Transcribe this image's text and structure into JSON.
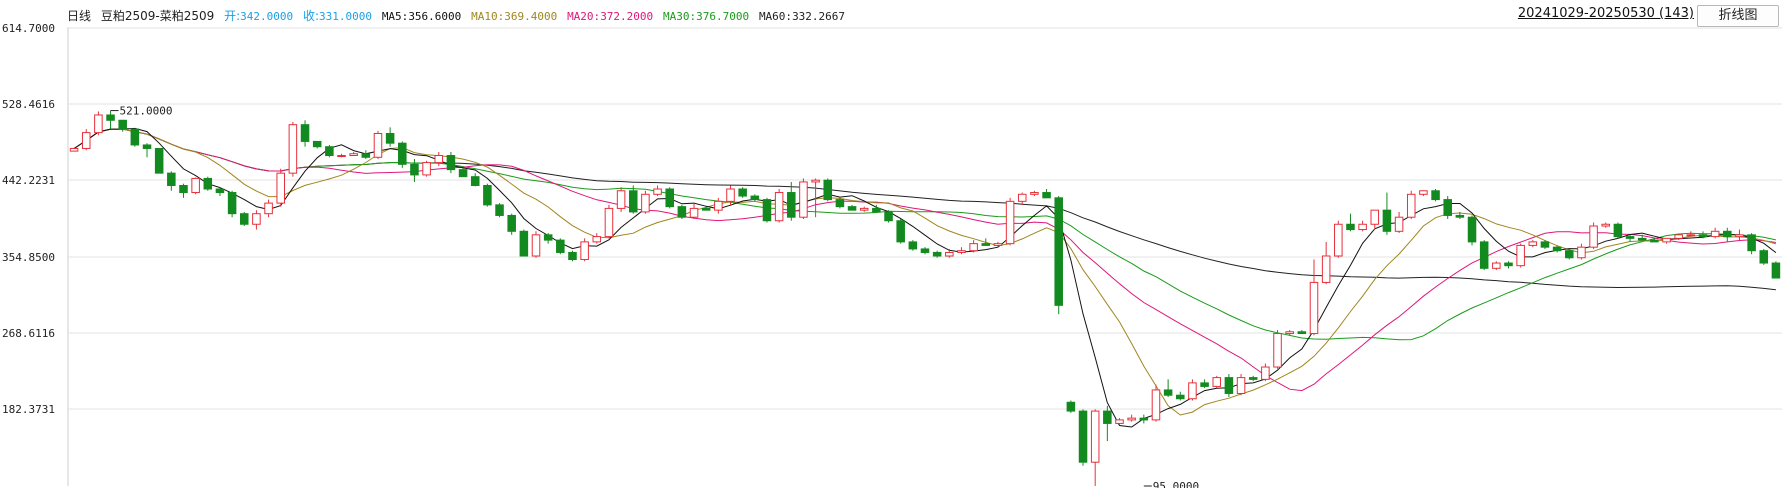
{
  "header": {
    "period": "日线",
    "symbol": "豆粕2509-菜粕2509",
    "open_label": "开:",
    "open_value": "342.0000",
    "close_label": "收:",
    "close_value": "331.0000",
    "ma5_label": "MA5:",
    "ma5_value": "356.6000",
    "ma10_label": "MA10:",
    "ma10_value": "369.4000",
    "ma20_label": "MA20:",
    "ma20_value": "372.2000",
    "ma30_label": "MA30:",
    "ma30_value": "376.7000",
    "ma60_label": "MA60:",
    "ma60_value": "332.2667"
  },
  "date_range": "20241029-20250530 (143)",
  "line_chart_button": "折线图",
  "colors": {
    "open": "#1aa0e6",
    "close": "#1aa0e6",
    "ma5": "#111111",
    "ma10": "#a0861e",
    "ma20": "#e0167a",
    "ma30": "#1a9c1a",
    "ma60": "#222222",
    "up": "#e8303a",
    "down": "#138a1f",
    "grid": "#e3e3e3"
  },
  "chart_data": {
    "type": "candlestick",
    "count": 143,
    "ylim": [
      95,
      614.7
    ],
    "y_ticks": [
      {
        "value": 614.7,
        "label": "614.7000"
      },
      {
        "value": 528.4616,
        "label": "528.4616"
      },
      {
        "value": 442.2231,
        "label": "442.2231"
      },
      {
        "value": 354.85,
        "label": "354.8500"
      },
      {
        "value": 268.6116,
        "label": "268.6116"
      },
      {
        "value": 182.3731,
        "label": "182.3731"
      }
    ],
    "annotations": [
      {
        "label": "521.0000",
        "value": 521.0,
        "index": 3
      },
      {
        "label": "95.0000",
        "value": 95.0,
        "index": 88
      }
    ],
    "ohlc": [
      [
        475,
        479,
        476,
        478
      ],
      [
        478,
        500,
        476,
        496
      ],
      [
        496,
        520,
        493,
        516
      ],
      [
        516,
        521,
        500,
        510
      ],
      [
        510,
        503,
        497,
        500
      ],
      [
        500,
        498,
        480,
        482
      ],
      [
        482,
        484,
        468,
        478
      ],
      [
        478,
        475,
        458,
        450
      ],
      [
        450,
        452,
        430,
        436
      ],
      [
        436,
        438,
        422,
        428
      ],
      [
        428,
        445,
        426,
        444
      ],
      [
        444,
        446,
        430,
        432
      ],
      [
        432,
        434,
        424,
        428
      ],
      [
        428,
        430,
        400,
        404
      ],
      [
        404,
        406,
        390,
        392
      ],
      [
        392,
        408,
        386,
        404
      ],
      [
        404,
        420,
        400,
        416
      ],
      [
        416,
        455,
        412,
        450
      ],
      [
        450,
        508,
        446,
        505
      ],
      [
        505,
        510,
        480,
        486
      ],
      [
        486,
        484,
        478,
        480
      ],
      [
        480,
        482,
        468,
        470
      ],
      [
        470,
        472,
        468,
        470
      ],
      [
        470,
        474,
        470,
        472
      ],
      [
        472,
        476,
        466,
        468
      ],
      [
        468,
        498,
        466,
        495
      ],
      [
        495,
        502,
        480,
        484
      ],
      [
        484,
        486,
        456,
        460
      ],
      [
        460,
        466,
        440,
        448
      ],
      [
        448,
        464,
        446,
        462
      ],
      [
        462,
        474,
        458,
        470
      ],
      [
        470,
        474,
        450,
        454
      ],
      [
        454,
        456,
        446,
        446
      ],
      [
        446,
        450,
        435,
        436
      ],
      [
        436,
        438,
        412,
        414
      ],
      [
        414,
        416,
        400,
        402
      ],
      [
        402,
        404,
        380,
        384
      ],
      [
        384,
        386,
        356,
        356
      ],
      [
        356,
        384,
        354,
        380
      ],
      [
        380,
        382,
        370,
        374
      ],
      [
        374,
        376,
        358,
        360
      ],
      [
        360,
        362,
        350,
        352
      ],
      [
        352,
        376,
        350,
        372
      ],
      [
        372,
        382,
        370,
        378
      ],
      [
        378,
        414,
        376,
        410
      ],
      [
        410,
        434,
        406,
        430
      ],
      [
        430,
        436,
        404,
        406
      ],
      [
        406,
        430,
        404,
        426
      ],
      [
        426,
        436,
        424,
        432
      ],
      [
        432,
        434,
        410,
        412
      ],
      [
        412,
        414,
        398,
        400
      ],
      [
        400,
        416,
        398,
        410
      ],
      [
        410,
        412,
        408,
        408
      ],
      [
        408,
        422,
        404,
        418
      ],
      [
        418,
        436,
        414,
        432
      ],
      [
        432,
        434,
        422,
        424
      ],
      [
        424,
        426,
        418,
        420
      ],
      [
        420,
        422,
        394,
        396
      ],
      [
        396,
        432,
        394,
        428
      ],
      [
        428,
        440,
        396,
        400
      ],
      [
        400,
        444,
        398,
        440
      ],
      [
        440,
        444,
        400,
        442
      ],
      [
        442,
        444,
        418,
        420
      ],
      [
        420,
        422,
        410,
        412
      ],
      [
        412,
        414,
        408,
        408
      ],
      [
        408,
        412,
        406,
        410
      ],
      [
        410,
        414,
        406,
        406
      ],
      [
        406,
        408,
        394,
        396
      ],
      [
        396,
        398,
        370,
        372
      ],
      [
        372,
        374,
        362,
        364
      ],
      [
        364,
        366,
        358,
        360
      ],
      [
        360,
        362,
        354,
        356
      ],
      [
        356,
        364,
        354,
        360
      ],
      [
        360,
        366,
        358,
        362
      ],
      [
        362,
        374,
        360,
        370
      ],
      [
        370,
        376,
        368,
        368
      ],
      [
        368,
        372,
        366,
        370
      ],
      [
        370,
        422,
        368,
        418
      ],
      [
        418,
        428,
        414,
        426
      ],
      [
        426,
        430,
        424,
        428
      ],
      [
        428,
        432,
        426,
        422
      ],
      [
        422,
        424,
        290,
        300
      ],
      [
        190,
        192,
        178,
        180
      ],
      [
        180,
        182,
        118,
        122
      ],
      [
        122,
        182,
        95,
        180
      ],
      [
        180,
        186,
        146,
        166
      ],
      [
        166,
        172,
        164,
        170
      ],
      [
        170,
        176,
        168,
        172
      ],
      [
        172,
        176,
        166,
        170
      ],
      [
        170,
        210,
        168,
        204
      ],
      [
        204,
        216,
        196,
        198
      ],
      [
        198,
        202,
        192,
        194
      ],
      [
        194,
        216,
        192,
        212
      ],
      [
        212,
        216,
        206,
        208
      ],
      [
        208,
        220,
        206,
        218
      ],
      [
        218,
        222,
        196,
        200
      ],
      [
        200,
        222,
        198,
        218
      ],
      [
        218,
        220,
        214,
        216
      ],
      [
        216,
        234,
        214,
        230
      ],
      [
        230,
        272,
        228,
        268
      ],
      [
        268,
        272,
        266,
        270
      ],
      [
        270,
        272,
        268,
        268
      ],
      [
        268,
        352,
        266,
        326
      ],
      [
        326,
        372,
        324,
        356
      ],
      [
        356,
        396,
        354,
        392
      ],
      [
        392,
        404,
        384,
        386
      ],
      [
        386,
        396,
        384,
        392
      ],
      [
        392,
        406,
        386,
        408
      ],
      [
        408,
        428,
        380,
        384
      ],
      [
        384,
        406,
        382,
        400
      ],
      [
        400,
        430,
        398,
        426
      ],
      [
        426,
        430,
        424,
        430
      ],
      [
        430,
        432,
        418,
        420
      ],
      [
        420,
        424,
        398,
        402
      ],
      [
        402,
        406,
        398,
        400
      ],
      [
        400,
        402,
        368,
        372
      ],
      [
        372,
        374,
        340,
        342
      ],
      [
        342,
        350,
        340,
        348
      ],
      [
        348,
        350,
        342,
        345
      ],
      [
        345,
        370,
        343,
        368
      ],
      [
        368,
        374,
        366,
        372
      ],
      [
        372,
        374,
        364,
        366
      ],
      [
        366,
        368,
        360,
        362
      ],
      [
        362,
        364,
        352,
        354
      ],
      [
        354,
        370,
        352,
        366
      ],
      [
        366,
        394,
        364,
        390
      ],
      [
        390,
        394,
        388,
        392
      ],
      [
        392,
        394,
        376,
        378
      ],
      [
        378,
        380,
        372,
        376
      ],
      [
        376,
        380,
        374,
        374
      ],
      [
        374,
        376,
        372,
        372
      ],
      [
        372,
        376,
        370,
        376
      ],
      [
        376,
        380,
        374,
        380
      ],
      [
        380,
        384,
        378,
        380
      ],
      [
        380,
        384,
        376,
        378
      ],
      [
        378,
        388,
        376,
        384
      ],
      [
        384,
        388,
        372,
        378
      ],
      [
        378,
        386,
        374,
        380
      ],
      [
        380,
        382,
        358,
        362
      ],
      [
        362,
        364,
        346,
        348
      ],
      [
        348,
        350,
        338,
        331
      ]
    ]
  }
}
